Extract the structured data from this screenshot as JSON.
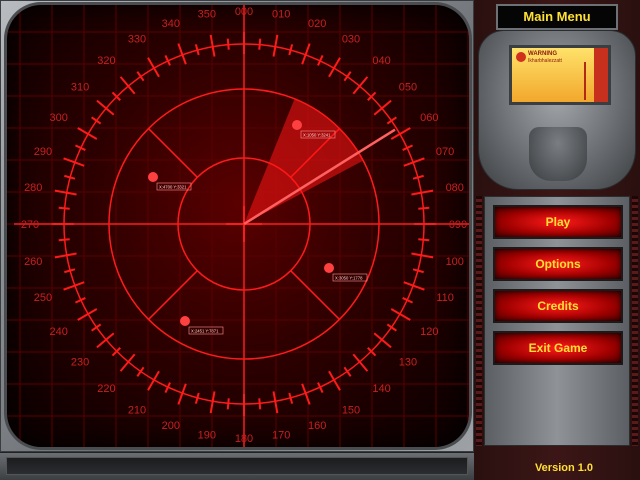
{
  "header": {
    "title": "Main Menu"
  },
  "warning_display": {
    "label": "WARNING",
    "subtext": "Ikharbhalezzatt"
  },
  "menu": {
    "items": [
      {
        "label": "Play"
      },
      {
        "label": "Options"
      },
      {
        "label": "Credits"
      },
      {
        "label": "Exit Game"
      }
    ]
  },
  "footer": {
    "version": "Version 1.0"
  },
  "radar": {
    "bearing_labels": [
      "000",
      "010",
      "020",
      "030",
      "040",
      "050",
      "060",
      "070",
      "080",
      "090",
      "100",
      "110",
      "120",
      "130",
      "140",
      "150",
      "160",
      "170",
      "180",
      "190",
      "200",
      "210",
      "220",
      "230",
      "240",
      "250",
      "260",
      "270",
      "280",
      "290",
      "300",
      "310",
      "320",
      "330",
      "340",
      "350"
    ],
    "contacts": [
      {
        "label": "X:1050 Y:3241"
      },
      {
        "label": "X:4700 Y:3321"
      },
      {
        "label": "X:3050 Y:1778"
      },
      {
        "label": "X:2451 Y:7871"
      }
    ]
  },
  "colors": {
    "radar_red": "#ff1a1a",
    "text_yellow": "#ffe033",
    "screen_bg": "#2d0000"
  }
}
